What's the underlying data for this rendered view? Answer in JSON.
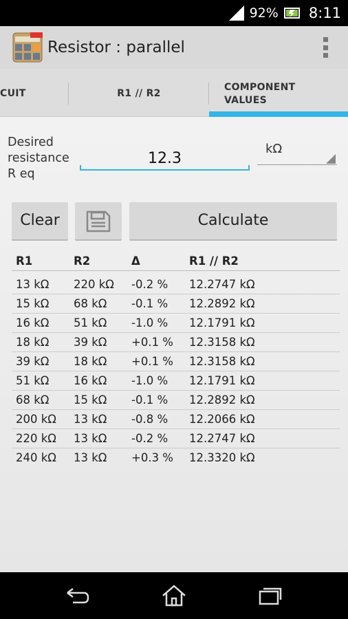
{
  "status_bar": {
    "battery": "92%",
    "time": "8:11",
    "icons": [
      "signal-icon",
      "battery-icon"
    ]
  },
  "action_bar": {
    "title": "Resistor : parallel",
    "app_icon_badge": "PRO",
    "app_icon_letters": "R L C",
    "icons": [
      "app-icon",
      "overflow-menu-icon"
    ]
  },
  "tabs": [
    {
      "label": "CUIT",
      "selected": false
    },
    {
      "label": "R1 // R2",
      "selected": false
    },
    {
      "label": "COMPONENT VALUES",
      "selected": true
    }
  ],
  "form": {
    "label": "Desired resistance R eq",
    "value": "12.3",
    "unit": "kΩ"
  },
  "buttons": {
    "clear": "Clear",
    "calculate": "Calculate",
    "save_icon": "save-icon"
  },
  "table": {
    "headers": [
      "R1",
      "R2",
      "Δ",
      "R1 // R2"
    ],
    "rows": [
      [
        "13 kΩ",
        "220 kΩ",
        "-0.2 %",
        "12.2747 kΩ"
      ],
      [
        "15 kΩ",
        "68 kΩ",
        "-0.1 %",
        "12.2892 kΩ"
      ],
      [
        "16 kΩ",
        "51 kΩ",
        "-1.0 %",
        "12.1791 kΩ"
      ],
      [
        "18 kΩ",
        "39 kΩ",
        "+0.1 %",
        "12.3158 kΩ"
      ],
      [
        "39 kΩ",
        "18 kΩ",
        "+0.1 %",
        "12.3158 kΩ"
      ],
      [
        "51 kΩ",
        "16 kΩ",
        "-1.0 %",
        "12.1791 kΩ"
      ],
      [
        "68 kΩ",
        "15 kΩ",
        "-0.1 %",
        "12.2892 kΩ"
      ],
      [
        "200 kΩ",
        "13 kΩ",
        "-0.8 %",
        "12.2066 kΩ"
      ],
      [
        "220 kΩ",
        "13 kΩ",
        "-0.2 %",
        "12.2747 kΩ"
      ],
      [
        "240 kΩ",
        "13 kΩ",
        "+0.3 %",
        "12.3320 kΩ"
      ]
    ]
  },
  "nav_bar": {
    "icons": [
      "back-icon",
      "home-icon",
      "recent-apps-icon"
    ]
  },
  "colors": {
    "accent": "#33b5e5",
    "action_bar": "#d9d9d9",
    "button": "#d8d8d8"
  }
}
